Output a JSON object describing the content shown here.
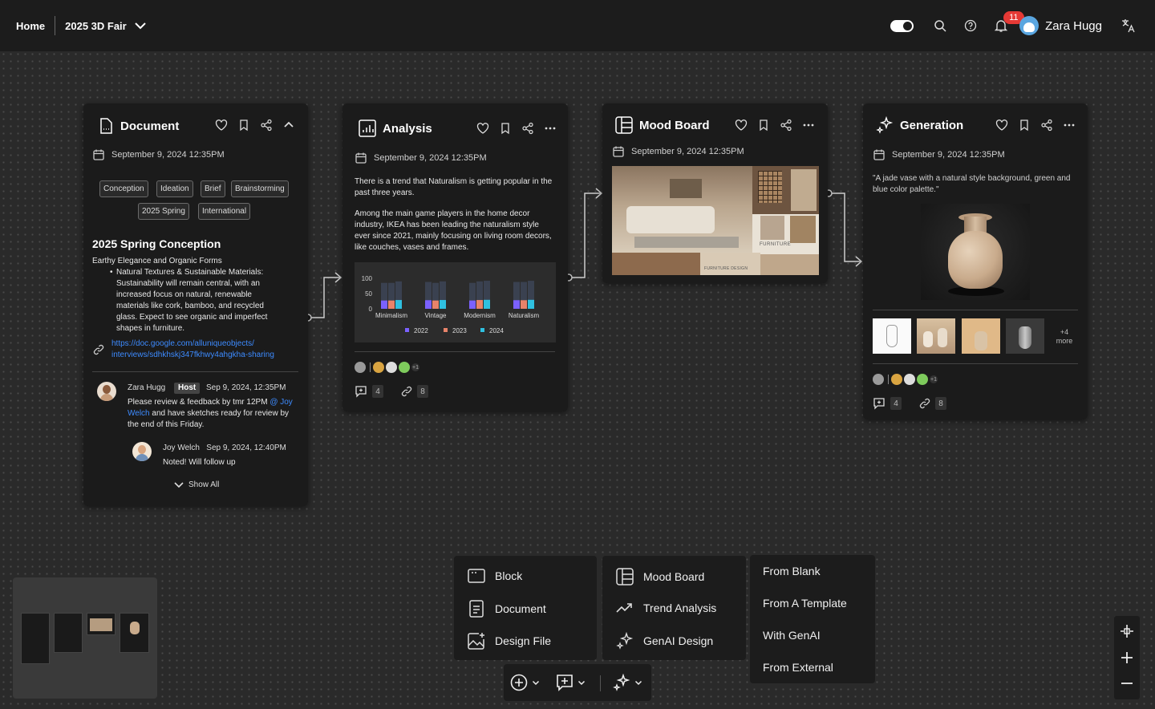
{
  "topbar": {
    "home": "Home",
    "project": "2025 3D Fair",
    "notifications": "11",
    "user": "Zara Hugg"
  },
  "document": {
    "title": "Document",
    "date": "September 9, 2024 12:35PM",
    "tags": [
      "Conception",
      "Ideation",
      "Brief",
      "Brainstorming",
      "2025 Spring",
      "International"
    ],
    "heading": "2025 Spring Conception",
    "subheading": "Earthy Elegance and Organic Forms",
    "bullet": "Natural Textures & Sustainable Materials: Sustainability will remain central, with an increased focus on natural, renewable materials like cork, bamboo, and recycled glass. Expect to see organic and imperfect shapes in furniture.",
    "link_line1": "https://doc.google.com/alluniqueobjects/",
    "link_line2": "interviews/sdhkhskj347fkhwy4ahgkha-sharing",
    "comment1": {
      "author": "Zara Hugg",
      "role": "Host",
      "time": "Sep 9, 2024, 12:35PM",
      "text_a": "Please review & feedback by tmr 12PM",
      "mention": "@ Joy Welch",
      "text_b": "and have sketches ready for review by the end of this Friday."
    },
    "comment2": {
      "author": "Joy Welch",
      "time": "Sep 9, 2024, 12:40PM",
      "text": "Noted! Will follow up"
    },
    "show_all": "Show All"
  },
  "analysis": {
    "title": "Analysis",
    "date": "September 9, 2024 12:35PM",
    "p1": "There is a trend that Naturalism is getting popular in the past three years.",
    "p2": "Among the main game players in the home decor industry, IKEA has been leading the naturalism style ever since 2021, mainly focusing on living room decors, like couches, vases and frames.",
    "comments": "4",
    "links": "8",
    "extra_avatars": "+1"
  },
  "chart_data": {
    "type": "bar",
    "categories": [
      "Minimalism",
      "Vintage",
      "Modernism",
      "Naturalism"
    ],
    "series": [
      {
        "name": "2022",
        "values": [
          85,
          88,
          85,
          88
        ]
      },
      {
        "name": "2023",
        "values": [
          85,
          85,
          90,
          88
        ]
      },
      {
        "name": "2024",
        "values": [
          90,
          90,
          92,
          92
        ]
      }
    ],
    "ylim": [
      0,
      100
    ],
    "yticks": [
      "100",
      "50",
      "0"
    ],
    "legend": "bottom",
    "colors": [
      "#7b61ff",
      "#e8836a",
      "#2fc0e0"
    ]
  },
  "moodboard": {
    "title": "Mood Board",
    "date": "September 9, 2024 12:35PM",
    "image_text_1": "FURNITURE",
    "image_text_2": "FURNITURE DESIGN"
  },
  "generation": {
    "title": "Generation",
    "date": "September 9, 2024 12:35PM",
    "prompt": "\"A jade vase with a natural style background, green and blue color palette.\"",
    "more_count": "+4",
    "more_label": "more",
    "comments": "4",
    "links": "8",
    "extra_avatars": "+1"
  },
  "menu_col1": [
    "Block",
    "Document",
    "Design File"
  ],
  "menu_col2": [
    "Mood Board",
    "Trend Analysis",
    "GenAI Design"
  ],
  "menu_col3": [
    "From Blank",
    "From A Template",
    "With GenAI",
    "From External"
  ]
}
